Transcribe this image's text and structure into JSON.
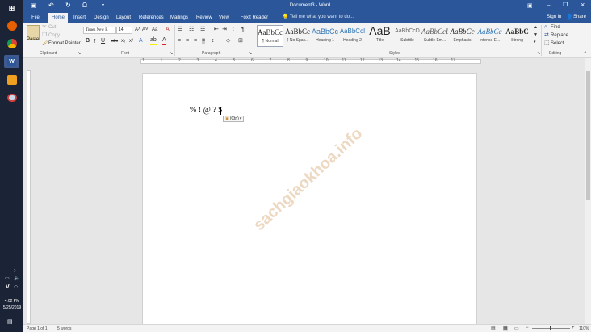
{
  "taskbar": {
    "time": "4:02 PM",
    "date": "5/25/2019",
    "lang": "V",
    "icons": [
      "windows-start-icon",
      "firefox-icon",
      "chrome-icon",
      "word-icon",
      "app-orange-icon",
      "app-round-icon"
    ]
  },
  "title": {
    "doc": "Document3 - Word",
    "qat": [
      "💾",
      "↶",
      "↻",
      "Ω"
    ]
  },
  "tabs": [
    "File",
    "Home",
    "Insert",
    "Design",
    "Layout",
    "References",
    "Mailings",
    "Review",
    "View",
    "Foxit Reader PDF"
  ],
  "tell_me": "Tell me what you want to do...",
  "sign_in": "Sign in",
  "share": "Share",
  "clipboard": {
    "paste": "Paste",
    "cut": "Cut",
    "copy": "Copy",
    "format_painter": "Format Painter",
    "label": "Clipboard"
  },
  "font": {
    "name": "Times New R",
    "size": "14",
    "label": "Font"
  },
  "paragraph": {
    "label": "Paragraph"
  },
  "styles": {
    "label": "Styles",
    "items": [
      {
        "preview": "AaBbCc",
        "name": "¶ Normal"
      },
      {
        "preview": "AaBbCc",
        "name": "¶ No Spac..."
      },
      {
        "preview": "AaBbCc",
        "name": "Heading 1"
      },
      {
        "preview": "AaBbCcI",
        "name": "Heading 2"
      },
      {
        "preview": "AaB",
        "name": "Title"
      },
      {
        "preview": "AaBbCcD",
        "name": "Subtitle"
      },
      {
        "preview": "AaBbCcL",
        "name": "Subtle Em..."
      },
      {
        "preview": "AaBbCc",
        "name": "Emphasis"
      },
      {
        "preview": "AaBbCc",
        "name": "Intense E..."
      },
      {
        "preview": "AaBbC",
        "name": "Strong"
      }
    ]
  },
  "editing": {
    "find": "Find",
    "replace": "Replace",
    "select": "Select",
    "label": "Editing"
  },
  "ruler_nums": [
    "1",
    "1",
    "2",
    "3",
    "4",
    "5",
    "6",
    "7",
    "8",
    "9",
    "10",
    "11",
    "12",
    "13",
    "14",
    "15",
    "16",
    "17"
  ],
  "document": {
    "text": "% ! @ ? $",
    "paste_opt": "(Ctrl)"
  },
  "watermark": "sachgiaokhoa.info",
  "status": {
    "page": "Page 1 of 1",
    "words": "5 words",
    "zoom": "110%"
  }
}
